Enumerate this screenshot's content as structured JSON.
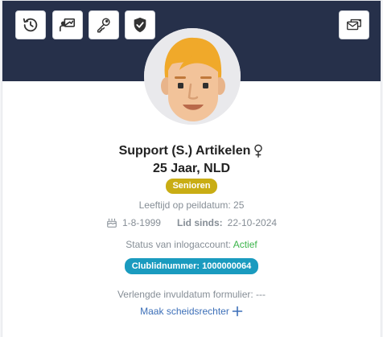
{
  "toolbar": {
    "buttons": [
      {
        "icon": "history-icon"
      },
      {
        "icon": "presentation-icon"
      },
      {
        "icon": "key-icon"
      },
      {
        "icon": "shield-check-icon"
      }
    ],
    "right_button": {
      "icon": "mail-transfer-icon"
    }
  },
  "profile": {
    "name": "Support (S.) Artikelen",
    "gender_icon": "female-icon",
    "age_country": "25 Jaar, NLD",
    "category_badge": "Senioren",
    "category_color": "#c9ad14",
    "peildatum_text": "Leeftijd op peildatum: 25",
    "birthdate": "1-8-1999",
    "member_since_label": "Lid sinds:",
    "member_since": "22-10-2024",
    "status_label": "Status van inlogaccount:",
    "status_value": "Actief",
    "status_color": "#3bb44a",
    "club_number": "Clublidnummer: 1000000064",
    "club_badge_color": "#1a9bbf",
    "extended_form_date": "Verlengde invuldatum formulier: ---",
    "make_referee_link": "Maak scheidsrechter"
  },
  "colors": {
    "header_bg": "#26304a",
    "link": "#3c6fb8"
  }
}
